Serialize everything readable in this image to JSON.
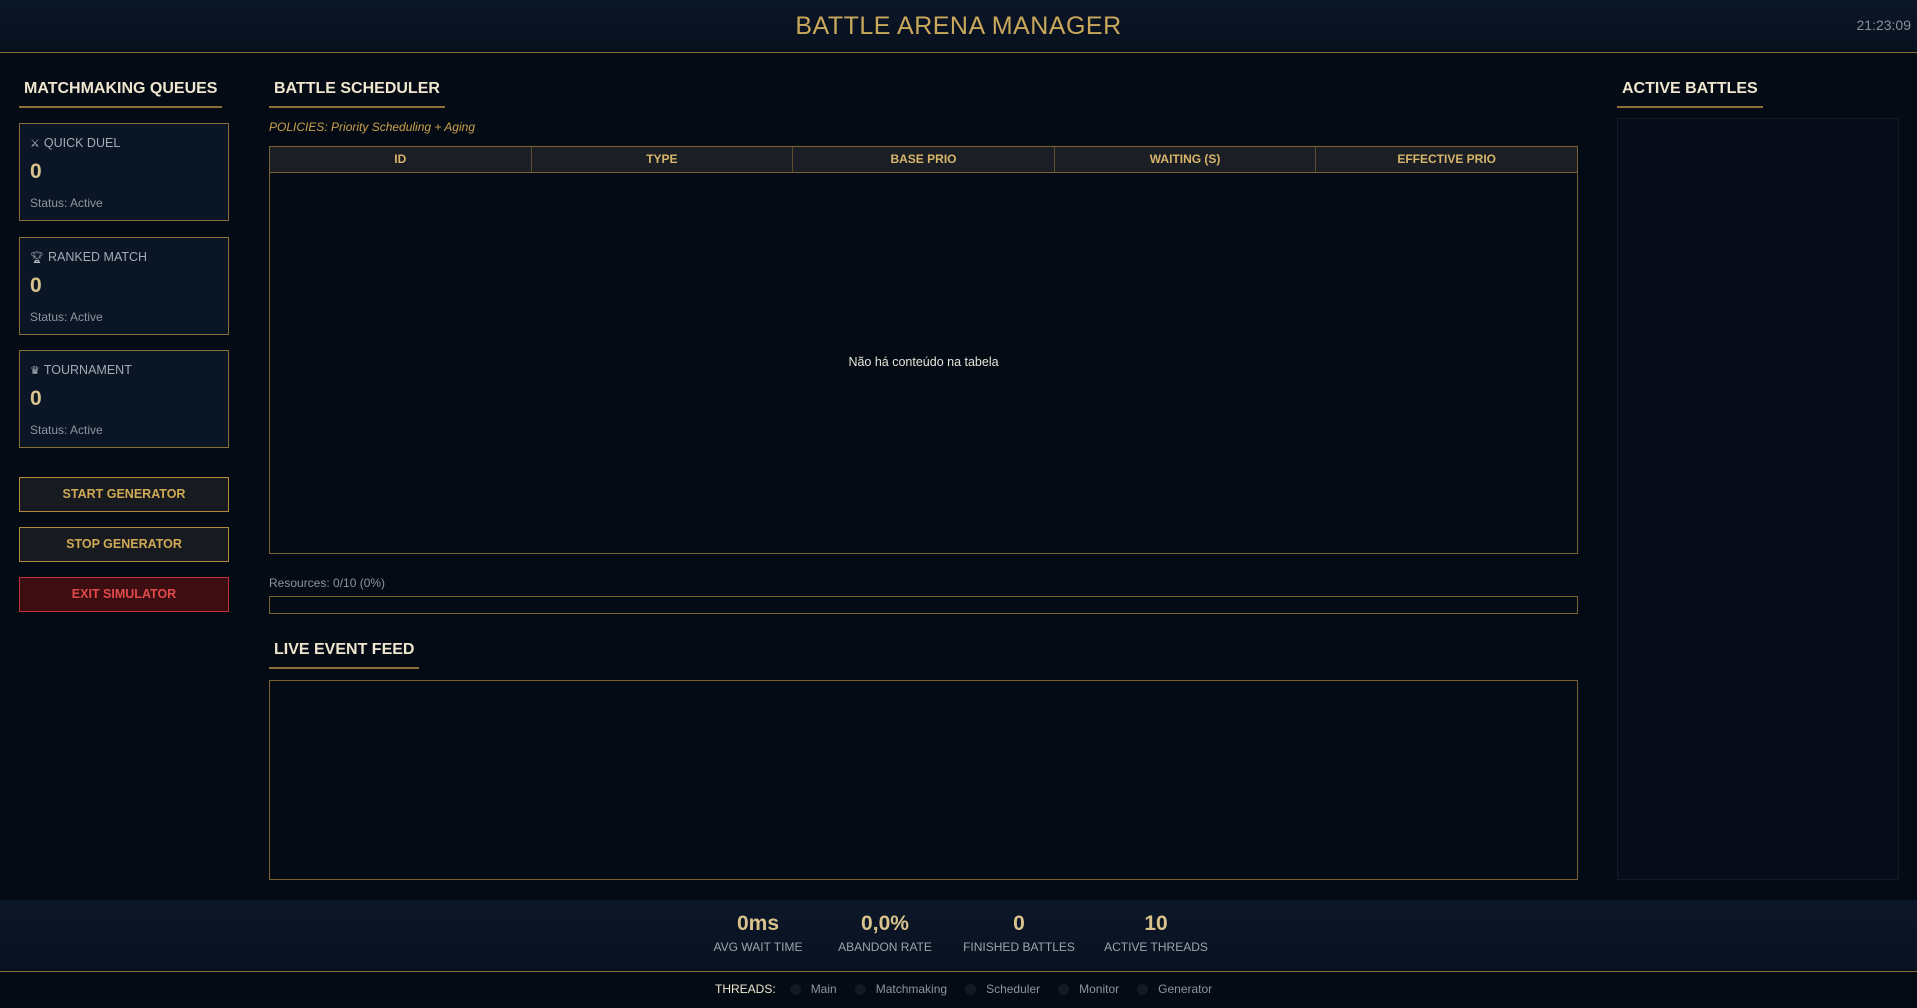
{
  "header": {
    "title": "BATTLE ARENA MANAGER",
    "clock": "21:23:09"
  },
  "queues": {
    "heading": "MATCHMAKING QUEUES",
    "items": [
      {
        "icon": "crossed-swords-icon",
        "name": "QUICK DUEL",
        "count": "0",
        "status": "Status: Active"
      },
      {
        "icon": "trophy-icon",
        "name": "RANKED MATCH",
        "count": "0",
        "status": "Status: Active"
      },
      {
        "icon": "crown-icon",
        "name": "TOURNAMENT",
        "count": "0",
        "status": "Status: Active"
      }
    ]
  },
  "controls": {
    "start_label": "START GENERATOR",
    "stop_label": "STOP GENERATOR",
    "exit_label": "EXIT SIMULATOR"
  },
  "scheduler": {
    "heading": "BATTLE SCHEDULER",
    "policies": "POLICIES: Priority Scheduling + Aging",
    "columns": [
      "ID",
      "TYPE",
      "BASE PRIO",
      "WAITING (S)",
      "EFFECTIVE PRIO"
    ],
    "empty_text": "Não há conteúdo na tabela",
    "resources_label": "Resources: 0/10 (0%)",
    "resources_fraction": 0
  },
  "feed": {
    "heading": "LIVE EVENT FEED"
  },
  "battles": {
    "heading": "ACTIVE BATTLES"
  },
  "stats": [
    {
      "value": "0ms",
      "label": "AVG WAIT TIME"
    },
    {
      "value": "0,0%",
      "label": "ABANDON RATE"
    },
    {
      "value": "0",
      "label": "FINISHED BATTLES"
    },
    {
      "value": "10",
      "label": "ACTIVE THREADS"
    }
  ],
  "threads": {
    "label": "THREADS:",
    "items": [
      "Main",
      "Matchmaking",
      "Scheduler",
      "Monitor",
      "Generator"
    ]
  },
  "colors": {
    "accent_gold": "#c9a85c",
    "background": "#050b14",
    "danger": "#e04a4a"
  }
}
